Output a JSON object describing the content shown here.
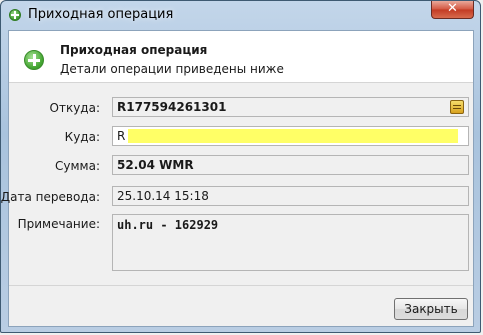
{
  "window": {
    "title": "Приходная операция",
    "close_glyph": "✕"
  },
  "header": {
    "title": "Приходная операция",
    "subtitle": "Детали операции приведены ниже",
    "icon": "green-plus-icon"
  },
  "fields": {
    "from": {
      "label": "Откуда:",
      "value": "R177594261301"
    },
    "to": {
      "label": "Куда:",
      "value": "R",
      "highlight_color": "#ffff66"
    },
    "amount": {
      "label": "Сумма:",
      "value": "52.04 WMR"
    },
    "date": {
      "label": "Дата перевода:",
      "value": "25.10.14 15:18"
    },
    "note": {
      "label": "Примечание:",
      "value": "uh.ru - 162929"
    }
  },
  "footer": {
    "close_label": "Закрыть"
  }
}
